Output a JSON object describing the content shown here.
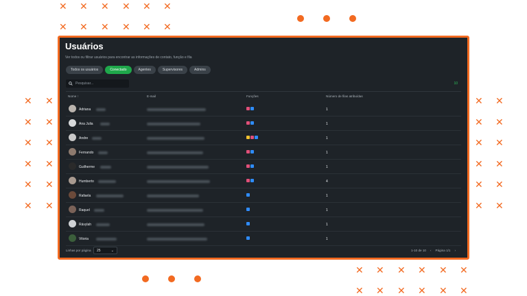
{
  "app": {
    "title": "Usuários",
    "subtitle": "Ver todos ou filtrar usuários para encontrar as informações de contato, função e fila"
  },
  "filters": [
    {
      "label": "Todos os usuários",
      "active": false
    },
    {
      "label": "Conectado",
      "active": true
    },
    {
      "label": "Agentes",
      "active": false
    },
    {
      "label": "Supervisores",
      "active": false
    },
    {
      "label": "Admins",
      "active": false
    }
  ],
  "search": {
    "placeholder": "Pesquisar...",
    "icon": "search-icon"
  },
  "result_count": "10",
  "table": {
    "headers": {
      "name": "Nome",
      "email": "E-mail",
      "roles": "Funções",
      "queues": "Número de filas atribuídas"
    },
    "rows": [
      {
        "first_name": "Adriana",
        "roles": [
          "#e0507a",
          "#2f8cff"
        ],
        "queues": "1"
      },
      {
        "first_name": "Ana Julia",
        "roles": [
          "#e0507a",
          "#2f8cff"
        ],
        "queues": "1"
      },
      {
        "first_name": "Andre",
        "roles": [
          "#f2c230",
          "#e0507a",
          "#2f8cff"
        ],
        "queues": "1"
      },
      {
        "first_name": "Fernando",
        "roles": [
          "#e0507a",
          "#2f8cff"
        ],
        "queues": "1"
      },
      {
        "first_name": "Guilherme",
        "roles": [
          "#e0507a",
          "#2f8cff"
        ],
        "queues": "1"
      },
      {
        "first_name": "Humberto",
        "roles": [
          "#e0507a",
          "#2f8cff"
        ],
        "queues": "4"
      },
      {
        "first_name": "Rafaela",
        "roles": [
          "#2f8cff"
        ],
        "queues": "1"
      },
      {
        "first_name": "Raquel",
        "roles": [
          "#2f8cff"
        ],
        "queues": "1"
      },
      {
        "first_name": "Rávylah",
        "roles": [
          "#2f8cff"
        ],
        "queues": "1"
      },
      {
        "first_name": "Vitoria",
        "roles": [
          "#2f8cff"
        ],
        "queues": "1"
      }
    ]
  },
  "footer": {
    "rows_per_page_label": "Linhas por página",
    "rows_per_page_value": "25",
    "range": "1-10 de 10",
    "page": "Página 1/1"
  },
  "colors": {
    "accent": "#f26a21",
    "active": "#1fa84b",
    "panel": "#1e2328"
  }
}
